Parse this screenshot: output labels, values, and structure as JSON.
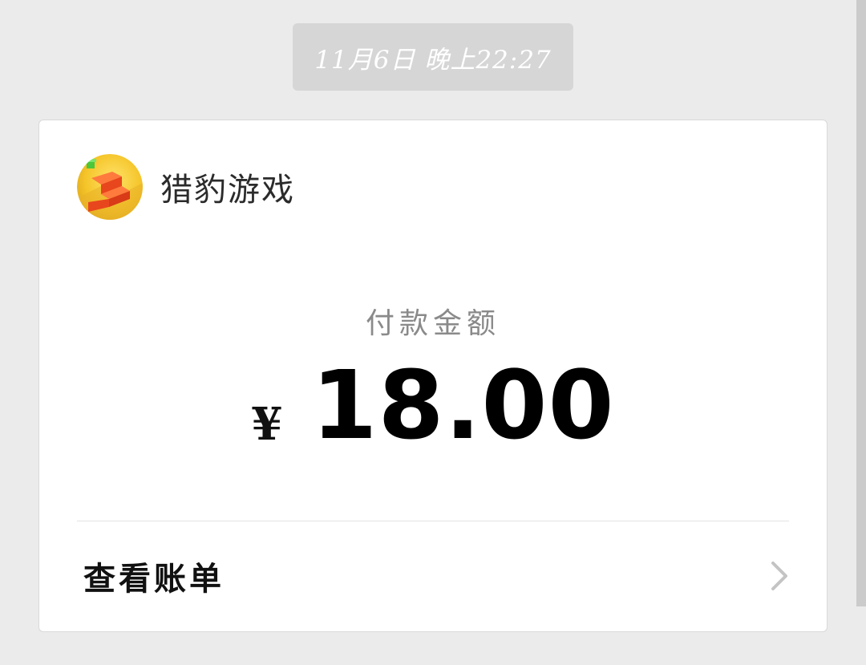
{
  "timestamp": "11月6日 晚上22:27",
  "merchant": {
    "name": "猎豹游戏",
    "logo_icon": "game-logo-icon"
  },
  "payment": {
    "label": "付款金额",
    "currency": "¥",
    "amount": "18.00"
  },
  "bill_link": {
    "label": "查看账单",
    "icon": "chevron-right-icon"
  }
}
